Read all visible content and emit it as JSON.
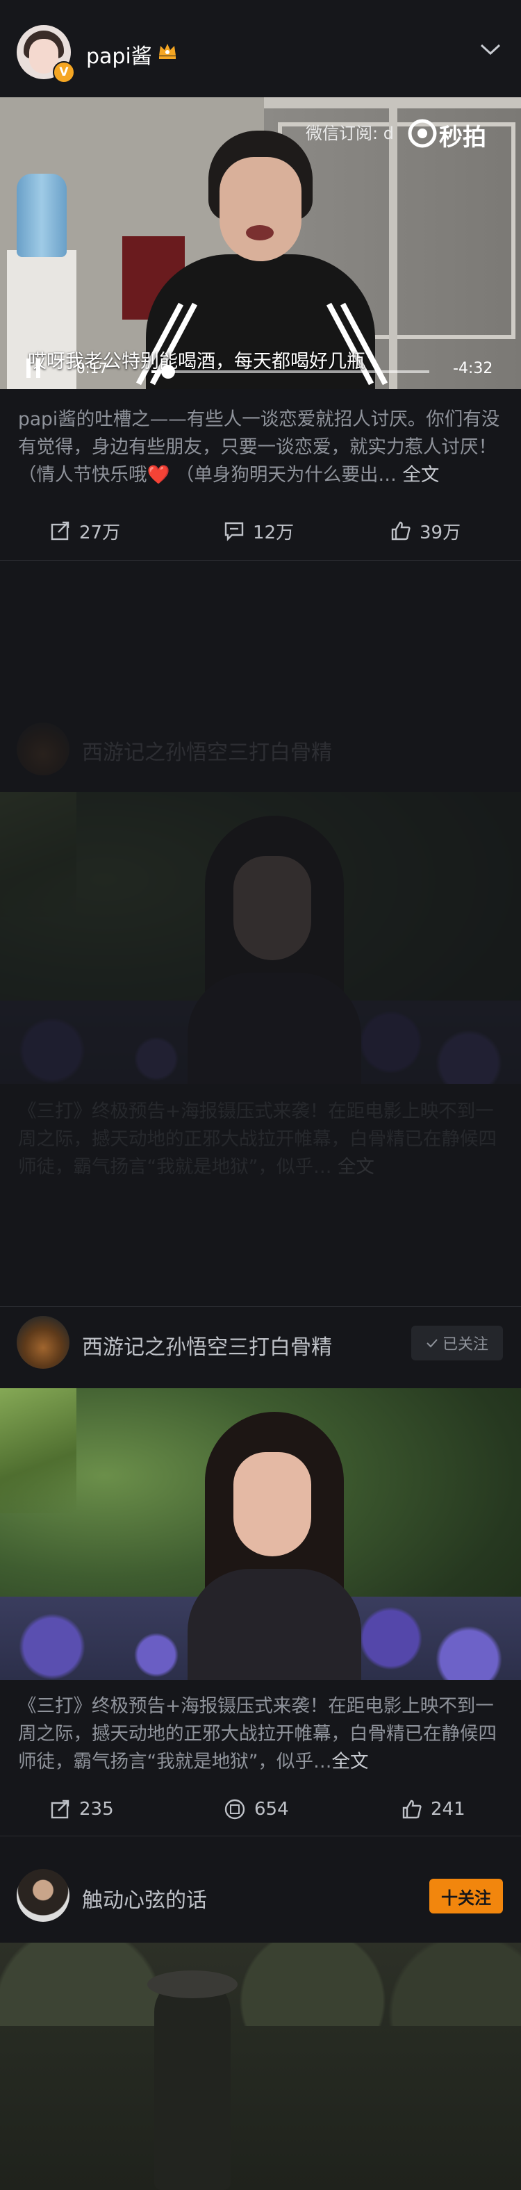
{
  "header": {
    "username": "papi酱",
    "verified_badge": "V",
    "crown_icon": "crown-badge-icon",
    "menu_icon": "chevron-down-icon"
  },
  "video": {
    "watermark": "微信订阅: d      ",
    "brand": "秒拍",
    "subtitle": "哎呀我老公特别能喝酒，每天都喝好几瓶",
    "current_time": "0:17",
    "total_time": "-4:32",
    "progress": 0.06
  },
  "post1": {
    "text": "papi酱的吐槽之——有些人一谈恋爱就招人讨厌。你们有没有觉得，身边有些朋友，只要一谈恋爱，就实力惹人讨厌！（情人节快乐哦",
    "text_tail": " （单身狗明天为什么要出…",
    "heart": "❤️",
    "full_text": "全文",
    "reposts": "27万",
    "comments": "12万",
    "likes": "39万"
  },
  "post2": {
    "author": "西游记之孙悟空三打白骨精",
    "follow_state": "已关注",
    "text": "《三打》终极预告+海报镊压式来袭！在距电影上映不到一周之际，撼天动地的正邪大战拉开帷幕，白骨精已在静候四师徒，霸气扬言“我就是地狱”，似乎…",
    "full_text": "全文",
    "reposts": "235",
    "comments": "654",
    "likes": "241"
  },
  "post3": {
    "author": "触动心弦的话",
    "follow_label": "十关注"
  },
  "colors": {
    "background": "#15161a",
    "follow_orange": "#f2860d",
    "verified_gold": "#f5a623"
  }
}
